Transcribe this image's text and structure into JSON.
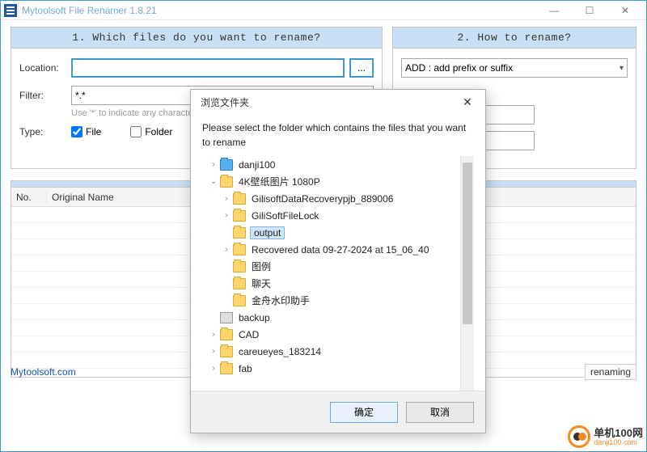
{
  "window": {
    "title": "Mytoolsoft File Renamer 1.8.21"
  },
  "leftPanel": {
    "header": "1. Which files do you want to rename?",
    "locationLabel": "Location:",
    "locationValue": "",
    "browseLabel": "...",
    "filterLabel": "Filter:",
    "filterValue": "*.*",
    "filterHint": "Use '*' to indicate any characters",
    "typeLabel": "Type:",
    "fileLabel": "File",
    "folderLabel": "Folder"
  },
  "rightPanel": {
    "header": "2. How to rename?",
    "methodSelected": "ADD : add prefix or suffix"
  },
  "table": {
    "colNo": "No.",
    "colName": "Original Name"
  },
  "status": {
    "link": "Mytoolsoft.com",
    "rightText": "renaming"
  },
  "brand": {
    "line1": "单机100网",
    "line2": "danji100.com"
  },
  "dialog": {
    "title": "浏览文件夹",
    "prompt": "Please select the folder which contains the files that you want to rename",
    "ok": "确定",
    "cancel": "取消",
    "tree": [
      {
        "indent": 0,
        "expander": "›",
        "iconType": "blue",
        "label": "danji100",
        "selected": false
      },
      {
        "indent": 0,
        "expander": "⌄",
        "iconType": "folder",
        "label": "4K壁纸图片 1080P",
        "selected": false
      },
      {
        "indent": 1,
        "expander": "›",
        "iconType": "folder",
        "label": "GilisoftDataRecoverypjb_889006",
        "selected": false
      },
      {
        "indent": 1,
        "expander": "›",
        "iconType": "folder",
        "label": "GiliSoftFileLock",
        "selected": false
      },
      {
        "indent": 1,
        "expander": "",
        "iconType": "folder",
        "label": "output",
        "selected": true
      },
      {
        "indent": 1,
        "expander": "›",
        "iconType": "folder",
        "label": "Recovered data 09-27-2024 at 15_06_40",
        "selected": false
      },
      {
        "indent": 1,
        "expander": "",
        "iconType": "folder",
        "label": "图例",
        "selected": false
      },
      {
        "indent": 1,
        "expander": "",
        "iconType": "folder",
        "label": "聊天",
        "selected": false
      },
      {
        "indent": 1,
        "expander": "",
        "iconType": "folder",
        "label": "金舟水印助手",
        "selected": false
      },
      {
        "indent": 0,
        "expander": "",
        "iconType": "print",
        "label": "backup",
        "selected": false
      },
      {
        "indent": 0,
        "expander": "›",
        "iconType": "folder",
        "label": "CAD",
        "selected": false
      },
      {
        "indent": 0,
        "expander": "›",
        "iconType": "folder",
        "label": "careueyes_183214",
        "selected": false
      },
      {
        "indent": 0,
        "expander": "›",
        "iconType": "folder",
        "label": "fab",
        "selected": false
      }
    ]
  }
}
